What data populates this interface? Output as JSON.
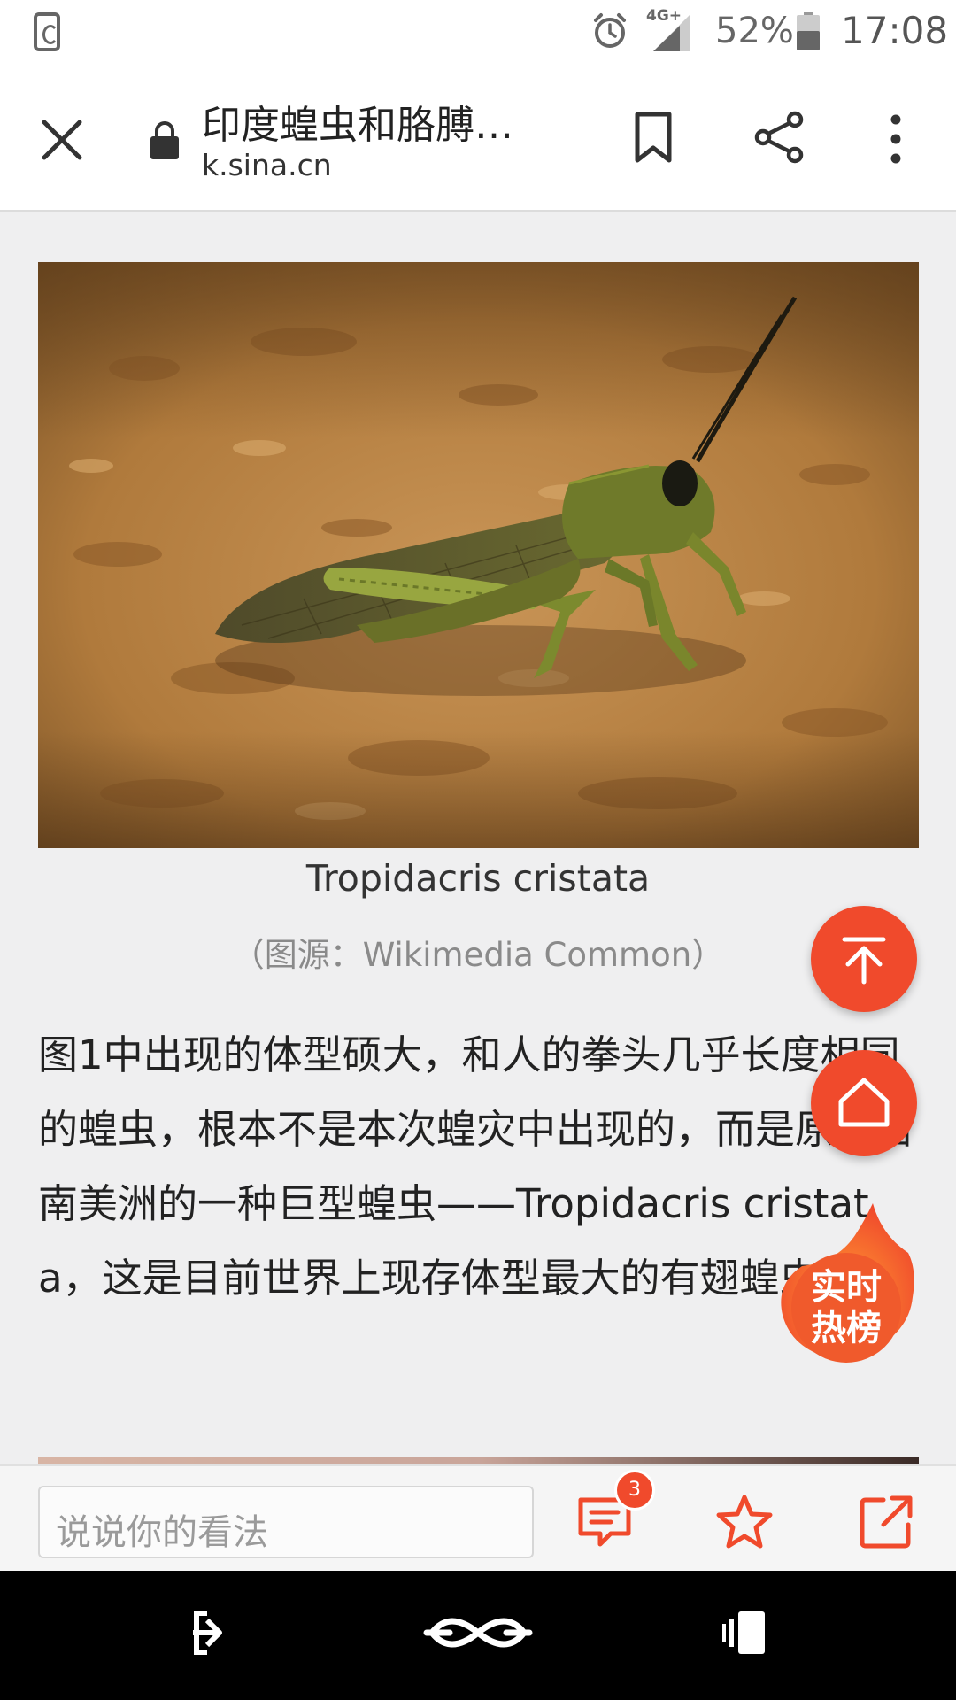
{
  "status_bar": {
    "network": "4G+",
    "battery": "52%",
    "time": "17:08"
  },
  "toolbar": {
    "title": "印度蝗虫和胳膊…",
    "url": "k.sina.cn"
  },
  "article": {
    "image_caption": "Tropidacris cristata",
    "image_credit": "（图源：Wikimedia Common）",
    "paragraph": "图1中出现的体型硕大，和人的拳头几乎长度相同的蝗虫，根本不是本次蝗灾中出现的，而是原产自南美洲的一种巨型蝗虫——Tropidacris cristata，这是目前世界上现存体型最大的有翅蝗虫。"
  },
  "floating": {
    "hot_line1": "实时",
    "hot_line2": "热榜"
  },
  "comment_bar": {
    "placeholder": "说说你的看法",
    "comment_count": "3"
  },
  "colors": {
    "accent": "#f04a2c",
    "status_gray": "#666666"
  }
}
